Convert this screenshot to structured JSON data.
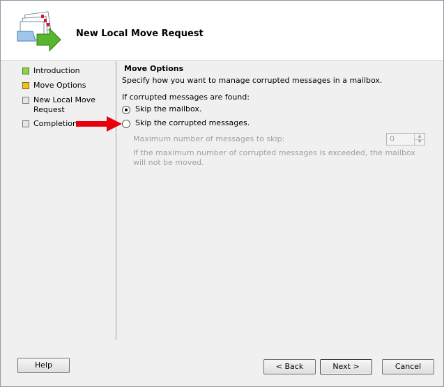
{
  "window": {
    "title": "New Local Move Request"
  },
  "nav": {
    "items": [
      {
        "label": "Introduction",
        "state": "done"
      },
      {
        "label": "Move Options",
        "state": "current"
      },
      {
        "label": "New Local Move Request",
        "state": "pending"
      },
      {
        "label": "Completion",
        "state": "pending"
      }
    ]
  },
  "content": {
    "section_title": "Move Options",
    "section_desc": "Specify how you want to manage corrupted messages in a mailbox.",
    "question": "If corrupted messages are found:",
    "option_skip_mailbox": "Skip the mailbox.",
    "option_skip_corrupted": "Skip the corrupted messages.",
    "selected_option": "skip-mailbox",
    "max_label": "Maximum number of messages to skip:",
    "max_value": "0",
    "note": "If the maximum number of corrupted messages is exceeded, the mailbox will not be moved."
  },
  "buttons": {
    "help": "Help",
    "back": "< Back",
    "next": "Next >",
    "cancel": "Cancel"
  },
  "colors": {
    "arrow": "#e8000b",
    "done": "#8fd14a",
    "current": "#f0c020",
    "disabled_text": "#a0a0a0"
  }
}
